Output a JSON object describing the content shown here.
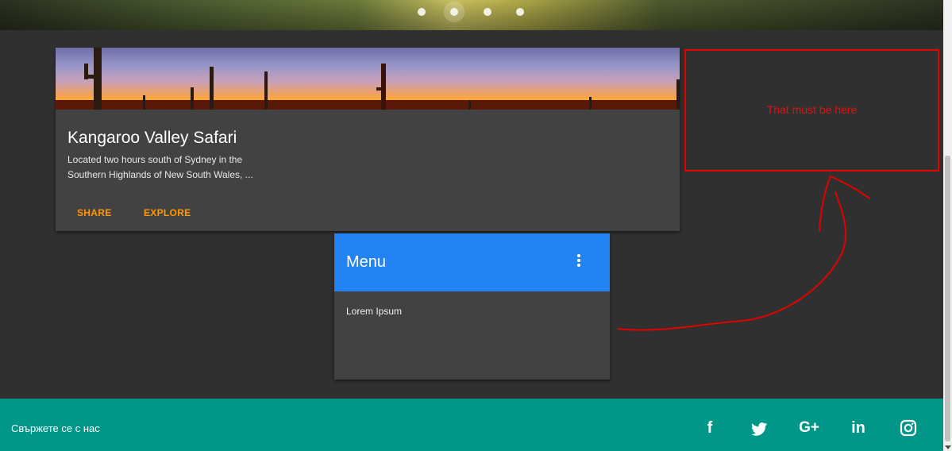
{
  "card": {
    "title": "Kangaroo Valley Safari",
    "text": "Located two hours south of Sydney in the Southern Highlands of New South Wales, ...",
    "actions": [
      "SHARE",
      "EXPLORE"
    ]
  },
  "menu_card": {
    "title": "Menu",
    "body": "Lorem Ipsum"
  },
  "annotation": {
    "text": "That must be here"
  },
  "footer": {
    "text": "Свържете се с нас",
    "social": [
      {
        "icon": "facebook-icon",
        "label": "f"
      },
      {
        "icon": "twitter-icon",
        "label": ""
      },
      {
        "icon": "google-plus-icon",
        "label": "G+"
      },
      {
        "icon": "linkedin-icon",
        "label": "in"
      },
      {
        "icon": "instagram-icon",
        "label": ""
      }
    ]
  },
  "colors": {
    "page_bg": "#303030",
    "card_bg": "#424242",
    "accent_orange": "#ff9800",
    "menu_header": "#2383f2",
    "footer_bg": "#009688",
    "annotation_red": "#e50000"
  }
}
